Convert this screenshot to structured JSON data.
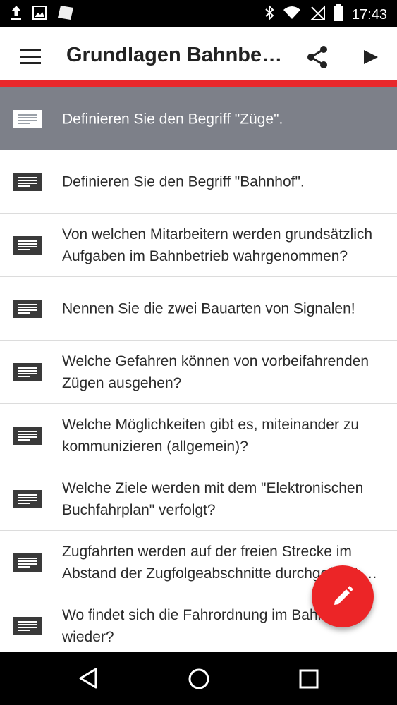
{
  "status_bar": {
    "time": "17:43",
    "icons": [
      "upload-icon",
      "image-icon",
      "note-icon",
      "bluetooth-icon",
      "wifi-icon",
      "no-sim-icon",
      "battery-icon"
    ]
  },
  "app_bar": {
    "title": "Grundlagen Bahnbetrieb",
    "icons": [
      "menu-icon",
      "share-icon",
      "play-icon"
    ]
  },
  "colors": {
    "accent": "#e8282b",
    "selected_row": "#7d8089",
    "fab": "#ec2527"
  },
  "cards": [
    {
      "text": "Definieren Sie den Begriff \"Züge\".",
      "selected": true
    },
    {
      "text": "Definieren Sie den Begriff \"Bahnhof\".",
      "selected": false
    },
    {
      "text": "Von welchen Mitarbeitern werden grundsätzlich Aufgaben im Bahnbetrieb wahrgenommen?",
      "selected": false
    },
    {
      "text": "Nennen Sie die zwei Bauarten von Signalen!",
      "selected": false
    },
    {
      "text": "Welche Gefahren können von vorbeifahrenden Zügen ausgehen?",
      "selected": false
    },
    {
      "text": "Welche Möglichkeiten gibt es, miteinander zu kommunizieren (allgemein)?",
      "selected": false
    },
    {
      "text": "Welche Ziele werden mit dem \"Elektronischen Buchfahrplan\" verfolgt?",
      "selected": false
    },
    {
      "text": "Zugfahrten werden auf der freien Strecke im Abstand der Zugfolgeabschnitte durchgeführt. Was ist das?",
      "selected": false
    },
    {
      "text": "Wo findet sich die Fahrordnung im Bahnhof wieder?",
      "selected": false
    }
  ],
  "fab": {
    "icon": "pencil-icon"
  },
  "nav_bar": {
    "icons": [
      "back-icon",
      "home-icon",
      "recents-icon"
    ]
  }
}
